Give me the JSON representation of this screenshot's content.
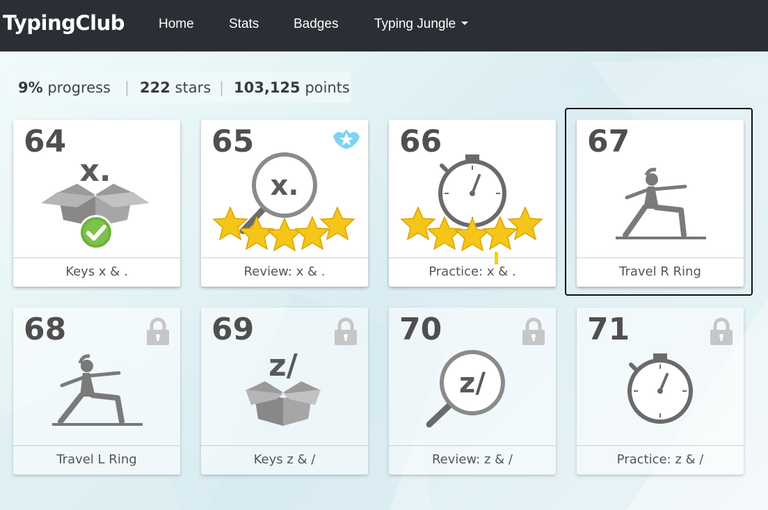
{
  "app": {
    "brand": "TypingClub"
  },
  "nav": {
    "items": [
      {
        "label": "Home"
      },
      {
        "label": "Stats"
      },
      {
        "label": "Badges"
      },
      {
        "label": "Typing Jungle"
      }
    ]
  },
  "stats": {
    "progress_value": "9%",
    "progress_label": "progress",
    "stars_value": "222",
    "stars_label": "stars",
    "points_value": "103,125",
    "points_label": "points",
    "separator": "|"
  },
  "lessons": [
    {
      "number": "64",
      "title": "Keys x & .",
      "icon": "open-box-icon",
      "keys": "x.",
      "stars": 0,
      "completed": true,
      "locked": false
    },
    {
      "number": "65",
      "title": "Review: x & .",
      "icon": "magnifier-icon",
      "keys": "x.",
      "stars": 5,
      "badge": "winged-star-badge-icon",
      "locked": false
    },
    {
      "number": "66",
      "title": "Practice: x & .",
      "icon": "stopwatch-icon",
      "stars": 5,
      "locked": false
    },
    {
      "number": "67",
      "title": "Travel R Ring",
      "icon": "yoga-pose-icon",
      "stars": 0,
      "locked": false,
      "selected": true
    },
    {
      "number": "68",
      "title": "Travel L Ring",
      "icon": "yoga-pose-icon",
      "stars": 0,
      "locked": true
    },
    {
      "number": "69",
      "title": "Keys z & /",
      "icon": "open-box-icon",
      "keys": "z/",
      "stars": 0,
      "locked": true
    },
    {
      "number": "70",
      "title": "Review: z & /",
      "icon": "magnifier-icon",
      "keys": "z/",
      "stars": 0,
      "locked": true
    },
    {
      "number": "71",
      "title": "Practice: z & /",
      "icon": "stopwatch-icon",
      "stars": 0,
      "locked": true
    }
  ],
  "colors": {
    "navbar": "#2b2f35",
    "star": "#f5c518",
    "check": "#6cb33e",
    "icon_gray": "#6a6a6a",
    "badge": "#7fd4f0"
  }
}
